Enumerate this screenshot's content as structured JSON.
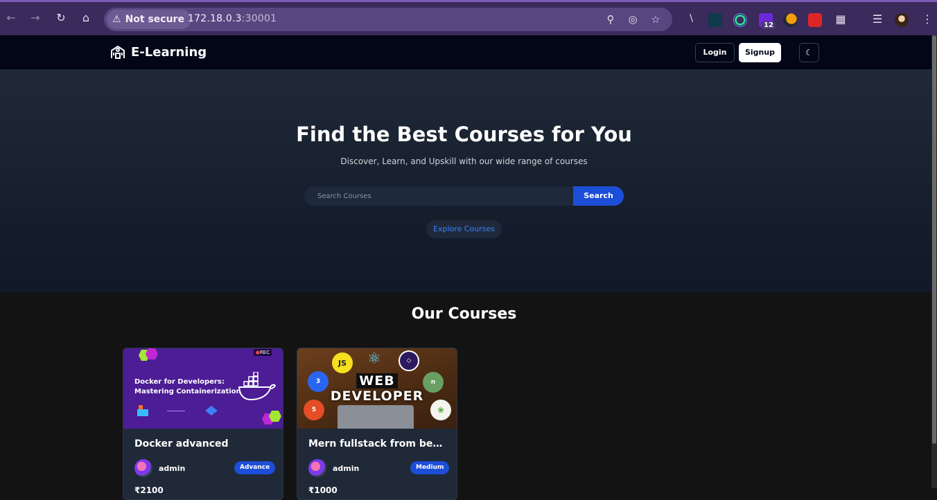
{
  "browser": {
    "security_label": "Not secure",
    "url_host": "172.18.0.3",
    "url_port": ":30001",
    "extension_badge": "12"
  },
  "nav": {
    "brand": "E-Learning",
    "login_label": "Login",
    "signup_label": "Signup"
  },
  "hero": {
    "title": "Find the Best Courses for You",
    "subtitle": "Discover, Learn, and Upskill with our wide range of courses",
    "search_placeholder": "Search Courses",
    "search_button": "Search",
    "explore_button": "Explore Courses"
  },
  "courses": {
    "heading": "Our Courses",
    "items": [
      {
        "thumb_line1": "Docker for Developers:",
        "thumb_line2": "Mastering Containerization",
        "thumb_rec": "REC",
        "title": "Docker advanced",
        "author": "admin",
        "level": "Advance",
        "price": "₹2100"
      },
      {
        "thumb_line1": "WEB",
        "thumb_line2": "DEVELOPER",
        "title": "Mern fullstack from begin...",
        "author": "admin",
        "level": "Medium",
        "price": "₹1000"
      }
    ]
  },
  "colors": {
    "accent": "#1d4ed8",
    "nav_bg": "#020617",
    "hero_bg": "#1f2937",
    "browser_frame": "#3b2a5c"
  }
}
